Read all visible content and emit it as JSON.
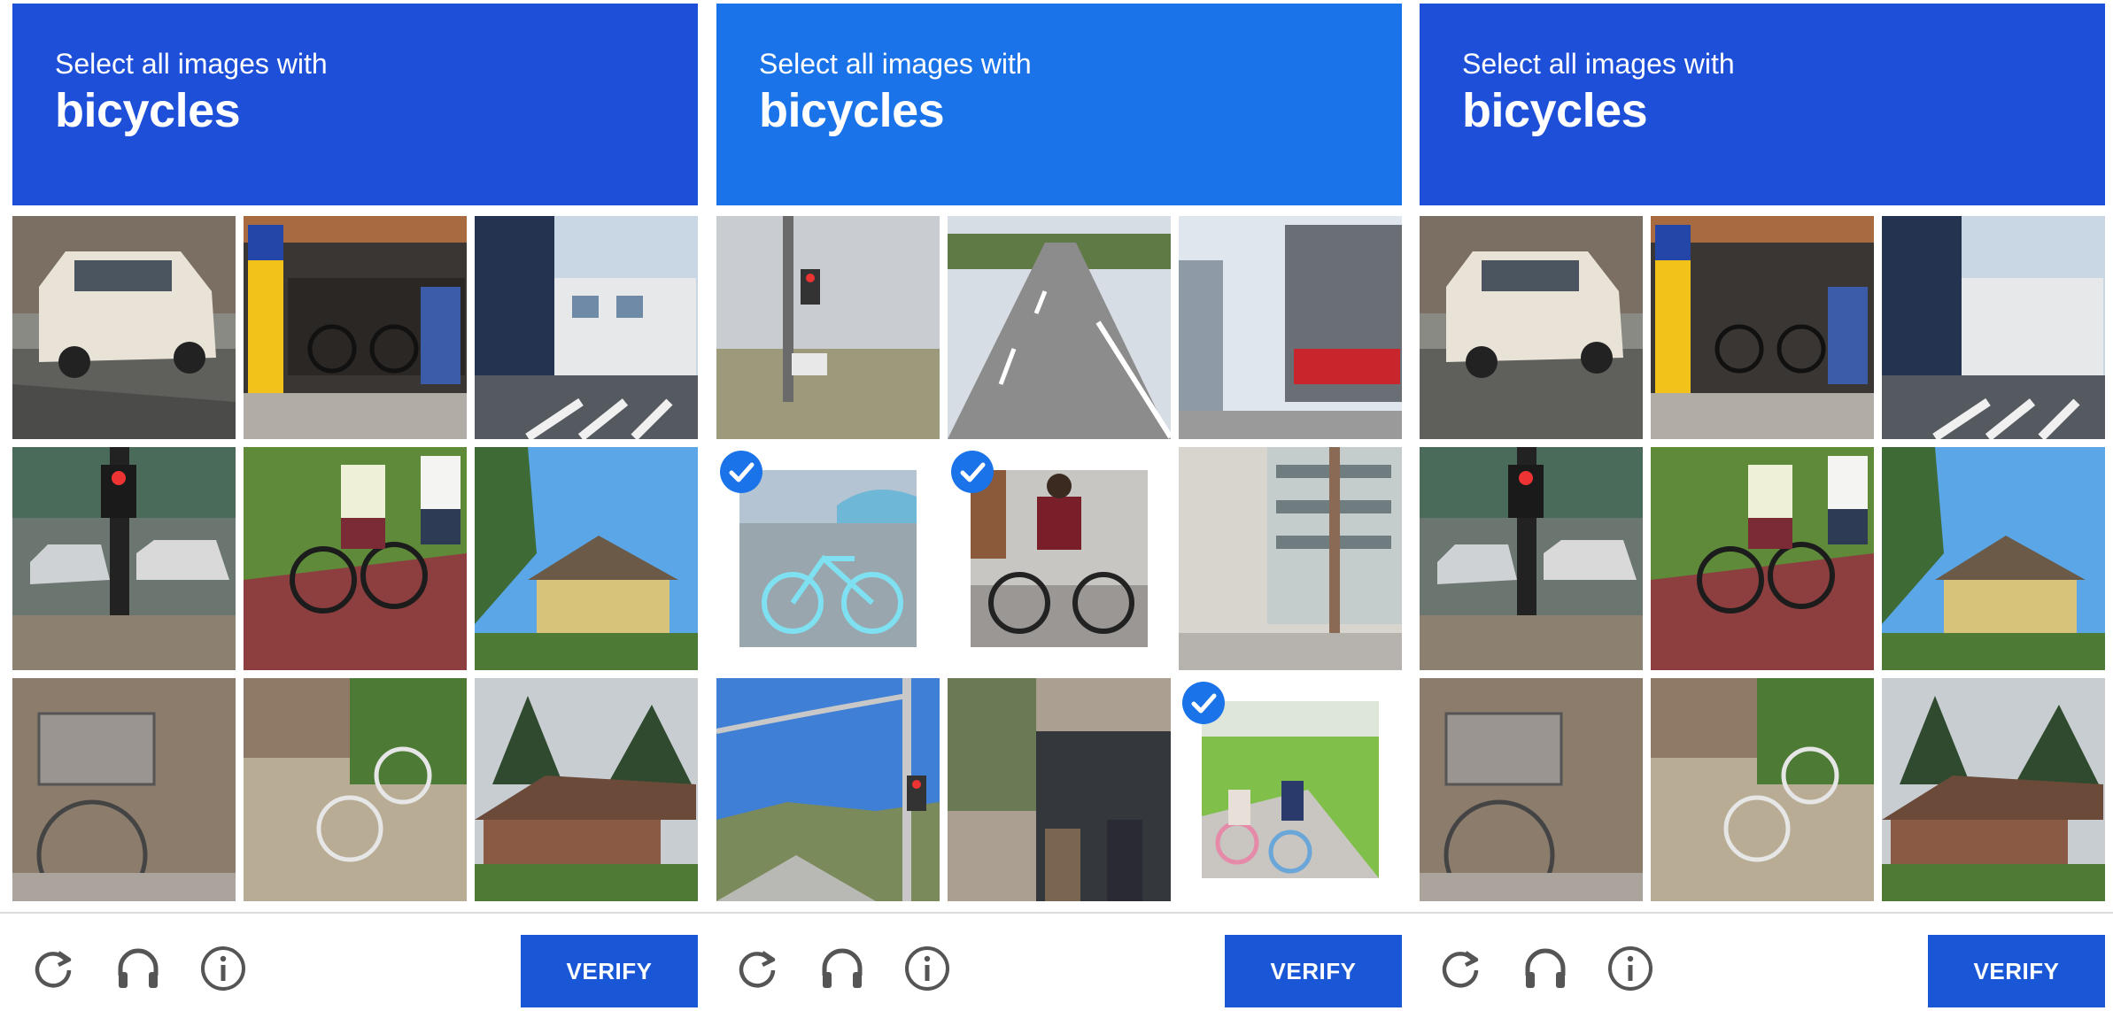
{
  "colors": {
    "header_panel1": "#1d4fd8",
    "header_panel2": "#1a73e8",
    "header_panel3": "#1d4fd8",
    "verify_button": "#1a57d6",
    "checkmark": "#1a73e8"
  },
  "panels": [
    {
      "instruction": "Select all images with",
      "target": "bicycles",
      "verify_label": "VERIFY",
      "tiles": [
        {
          "scene": "white car parked on street",
          "selected": false
        },
        {
          "scene": "yellow sign and bike parking",
          "selected": false
        },
        {
          "scene": "street with buildings and crosswalk",
          "selected": false
        },
        {
          "scene": "traffic light and cars",
          "selected": false
        },
        {
          "scene": "cyclists on red path",
          "selected": false
        },
        {
          "scene": "yellow house under blue sky",
          "selected": false
        },
        {
          "scene": "bicycle with basket",
          "selected": false
        },
        {
          "scene": "parked bicycle on pavement",
          "selected": false
        },
        {
          "scene": "brick house with trees",
          "selected": false
        }
      ]
    },
    {
      "instruction": "Select all images with",
      "target": "bicycles",
      "verify_label": "VERIFY",
      "tiles": [
        {
          "scene": "traffic light over field",
          "selected": false
        },
        {
          "scene": "empty highway",
          "selected": false
        },
        {
          "scene": "city buildings and shop",
          "selected": false
        },
        {
          "scene": "light blue bicycle",
          "selected": true
        },
        {
          "scene": "cyclist in red shirt",
          "selected": true
        },
        {
          "scene": "apartment buildings",
          "selected": false
        },
        {
          "scene": "road and traffic light under blue sky",
          "selected": false
        },
        {
          "scene": "people on stairs",
          "selected": false
        },
        {
          "scene": "children riding bikes",
          "selected": true
        }
      ]
    },
    {
      "instruction": "Select all images with",
      "target": "bicycles",
      "verify_label": "VERIFY",
      "tiles": [
        {
          "scene": "white car parked on street",
          "selected": false
        },
        {
          "scene": "yellow sign and bike parking",
          "selected": false
        },
        {
          "scene": "street with buildings and crosswalk",
          "selected": false
        },
        {
          "scene": "traffic light and cars",
          "selected": false
        },
        {
          "scene": "cyclists on red path",
          "selected": false
        },
        {
          "scene": "yellow house under blue sky",
          "selected": false
        },
        {
          "scene": "bicycle with basket",
          "selected": false
        },
        {
          "scene": "parked bicycle on pavement",
          "selected": false
        },
        {
          "scene": "brick house with trees",
          "selected": false
        }
      ]
    }
  ],
  "icons": [
    "reload-icon",
    "headphones-icon",
    "info-icon"
  ]
}
